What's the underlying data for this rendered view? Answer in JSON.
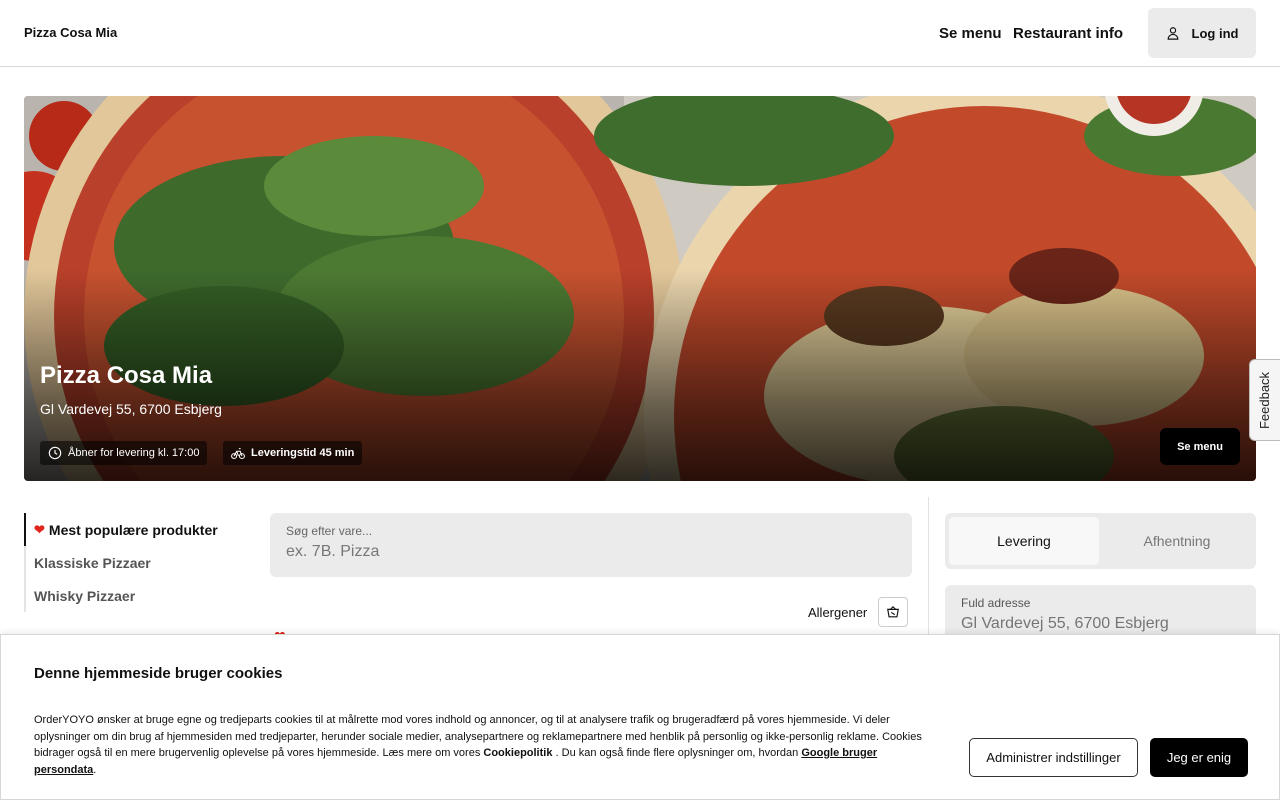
{
  "header": {
    "brand": "Pizza Cosa Mia",
    "nav": {
      "menu": "Se menu",
      "info": "Restaurant info"
    },
    "login": "Log ind"
  },
  "hero": {
    "title": "Pizza Cosa Mia",
    "address": "Gl Vardevej 55, 6700 Esbjerg",
    "opening": "Åbner for levering kl. 17:00",
    "delivery_time": "Leveringstid 45 min",
    "menu_button": "Se menu"
  },
  "feedback": "Feedback",
  "categories": [
    {
      "label": "Mest populære produkter",
      "icon": "heart-icon",
      "active": true
    },
    {
      "label": "Klassiske Pizzaer",
      "active": false
    },
    {
      "label": "Whisky Pizzaer",
      "active": false
    }
  ],
  "search": {
    "label": "Søg efter vare...",
    "placeholder": "ex. 7B. Pizza",
    "value": ""
  },
  "allergens": {
    "label": "Allergener",
    "icon": "allergen-icon"
  },
  "order_panel": {
    "tabs": [
      "Levering",
      "Afhentning"
    ],
    "selected_tab": "Levering",
    "address_label": "Fuld adresse",
    "address_placeholder": "Gl Vardevej 55, 6700 Esbjerg"
  },
  "cookie": {
    "title": "Denne hjemmeside bruger cookies",
    "text_1": "OrderYOYO ønsker at bruge egne og tredjeparts cookies til at målrette mod vores indhold og annoncer, og til at analysere trafik og brugeradfærd på vores hjemmeside. Vi deler oplysninger om din brug af hjemmesiden med tredjeparter, herunder sociale medier, analysepartnere og reklamepartnere med henblik på personlig og ikke-personlig reklame. Cookies bidrager også til en mere brugervenlig oplevelse på vores hjemmeside. Læs mere om vores ",
    "link_1": "Cookiepolitik",
    "text_2": " . Du kan også finde flere oplysninger om, hvordan ",
    "link_2": "Google bruger persondata",
    "text_3": ".",
    "manage_button": "Administrer indstillinger",
    "agree_button": "Jeg er enig"
  },
  "colors": {
    "accent": "#000000",
    "heart": "#e0251b",
    "panel_bg": "#ebebeb"
  }
}
